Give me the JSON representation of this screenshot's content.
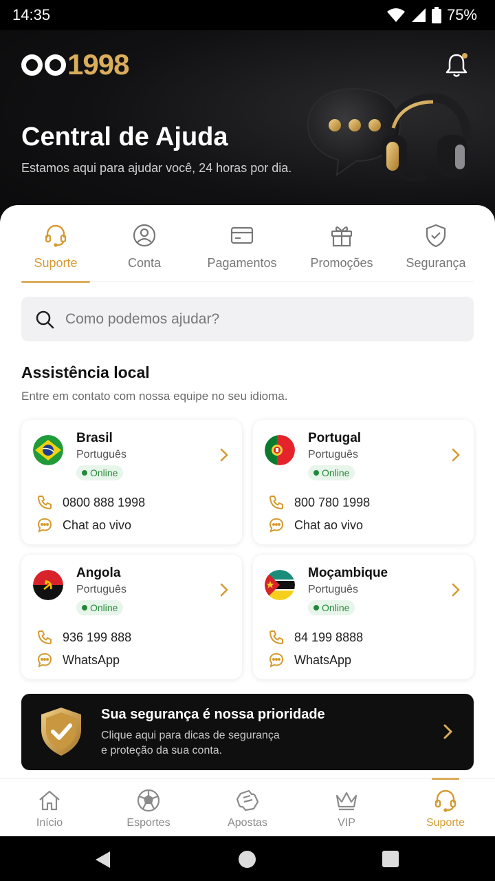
{
  "status": {
    "time": "14:35",
    "battery": "75%"
  },
  "hero": {
    "logo_text": "1998",
    "title": "Central de Ajuda",
    "subtitle": "Estamos aqui para ajudar você, 24 horas por dia."
  },
  "tabs": [
    {
      "label": "Suporte",
      "icon": "headset-icon",
      "active": true
    },
    {
      "label": "Conta",
      "icon": "user-icon"
    },
    {
      "label": "Pagamentos",
      "icon": "card-icon"
    },
    {
      "label": "Promoções",
      "icon": "gift-icon"
    },
    {
      "label": "Segurança",
      "icon": "shield-check-icon"
    }
  ],
  "search": {
    "placeholder": "Como podemos ajudar?"
  },
  "local": {
    "title": "Assistência local",
    "subtitle": "Entre em contato com nossa equipe no seu idioma.",
    "cards": [
      {
        "country": "Brasil",
        "language": "Português",
        "status": "Online",
        "phone": "0800 888 1998",
        "channel": "Chat ao vivo"
      },
      {
        "country": "Portugal",
        "language": "Português",
        "status": "Online",
        "phone": "800 780 1998",
        "channel": "Chat ao vivo"
      },
      {
        "country": "Angola",
        "language": "Português",
        "status": "Online",
        "phone": "936 199 888",
        "channel": "WhatsApp"
      },
      {
        "country": "Moçambique",
        "language": "Português",
        "status": "Online",
        "phone": "84 199 8888",
        "channel": "WhatsApp"
      }
    ]
  },
  "security": {
    "title": "Sua segurança é nossa prioridade",
    "desc_line1": "Clique aqui para dicas de segurança",
    "desc_line2": "e proteção da sua conta."
  },
  "nav": [
    {
      "label": "Início",
      "icon": "home-icon"
    },
    {
      "label": "Esportes",
      "icon": "soccer-ball-icon"
    },
    {
      "label": "Apostas",
      "icon": "ticket-icon"
    },
    {
      "label": "VIP",
      "icon": "crown-icon"
    },
    {
      "label": "Suporte",
      "icon": "headset-icon",
      "active": true
    }
  ],
  "colors": {
    "accent": "#d9ab5a",
    "online": "#23883a",
    "dark": "#0f0f10"
  }
}
